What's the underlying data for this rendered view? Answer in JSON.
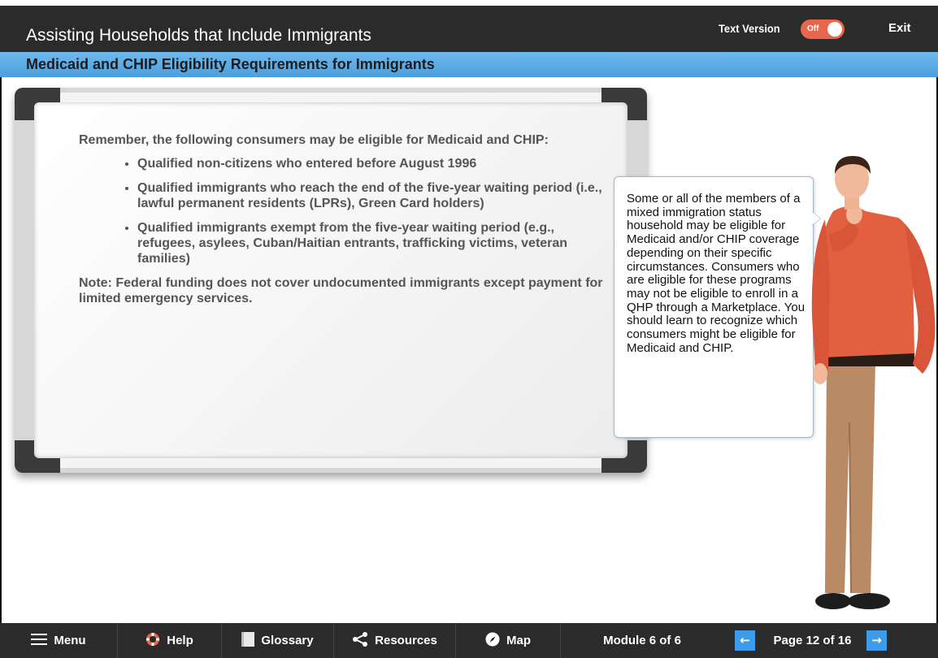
{
  "header": {
    "course_title": "Assisting Households that Include Immigrants",
    "text_version_label": "Text Version",
    "toggle_state": "Off",
    "exit_label": "Exit",
    "accent_color": "#e8664d"
  },
  "subheader": {
    "page_heading": "Medicaid and CHIP Eligibility Requirements for Immigrants"
  },
  "whiteboard": {
    "intro": "Remember, the following consumers may be eligible for Medicaid and CHIP:",
    "bullets": [
      "Qualified non-citizens who entered before August 1996",
      "Qualified immigrants who reach the end of the five-year waiting period (i.e., lawful permanent residents (LPRs), Green Card holders)",
      "Qualified immigrants exempt from the five-year waiting period (e.g., refugees, asylees, Cuban/Haitian entrants, trafficking victims, veteran families)"
    ],
    "note": "Note: Federal funding does not cover undocumented immigrants except payment for limited emergency services."
  },
  "callout": {
    "text": "Some or all of the members of a mixed immigration status household may be eligible for Medicaid and/or CHIP coverage depending on their specific circumstances. Consumers who are eligible for these programs may not be eligible to enroll in a QHP through a Marketplace. You should learn to recognize which consumers might be eligible for Medicaid and CHIP."
  },
  "footer": {
    "nav": [
      {
        "label": "Menu",
        "icon": "hamburger-icon"
      },
      {
        "label": "Help",
        "icon": "lifebuoy-icon"
      },
      {
        "label": "Glossary",
        "icon": "book-icon"
      },
      {
        "label": "Resources",
        "icon": "share-icon"
      },
      {
        "label": "Map",
        "icon": "compass-icon"
      }
    ],
    "module_label": "Module 6 of 6",
    "page_label": "Page 12 of 16",
    "pager_color": "#3d9be9"
  }
}
